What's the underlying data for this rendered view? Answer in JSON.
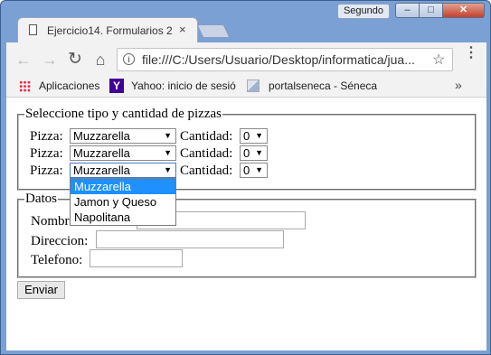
{
  "window": {
    "user_badge": "Segundo",
    "minimize_glyph": "–",
    "maximize_glyph": "□",
    "close_glyph": "✕"
  },
  "tab": {
    "title": "Ejercicio14. Formularios 2",
    "close_glyph": "×",
    "icon": "document-icon"
  },
  "toolbar": {
    "back_glyph": "←",
    "forward_glyph": "→",
    "reload_glyph": "↻",
    "home_glyph": "⌂",
    "url": "file:///C:/Users/Usuario/Desktop/informatica/jua...",
    "info_glyph": "i",
    "star_glyph": "☆",
    "menu_glyph": "⋮"
  },
  "bookmarks": {
    "items": [
      {
        "label": "Aplicaciones",
        "icon": "apps-icon"
      },
      {
        "label": "Yahoo: inicio de sesió",
        "icon": "yahoo-icon",
        "icon_glyph": "Y"
      },
      {
        "label": "portalseneca - Séneca",
        "icon": "seneca-icon"
      }
    ],
    "overflow_glyph": "»"
  },
  "form": {
    "pizzas_legend": "Seleccione tipo y cantidad de pizzas",
    "pizza_label": "Pizza:",
    "cantidad_label": "Cantidad:",
    "rows": [
      {
        "pizza": "Muzzarella",
        "cantidad": "0"
      },
      {
        "pizza": "Muzzarella",
        "cantidad": "0"
      },
      {
        "pizza": "Muzzarella",
        "cantidad": "0"
      }
    ],
    "dropdown_options": [
      "Muzzarella",
      "Jamon y Queso",
      "Napolitana"
    ],
    "datos_legend": "Datos",
    "nombre_label": "Nombre:",
    "direccion_label": "Direccion:",
    "telefono_label": "Telefono:",
    "submit_label": "Enviar"
  },
  "colors": {
    "highlight": "#1e90ff",
    "frame": "#7aa0d4"
  }
}
